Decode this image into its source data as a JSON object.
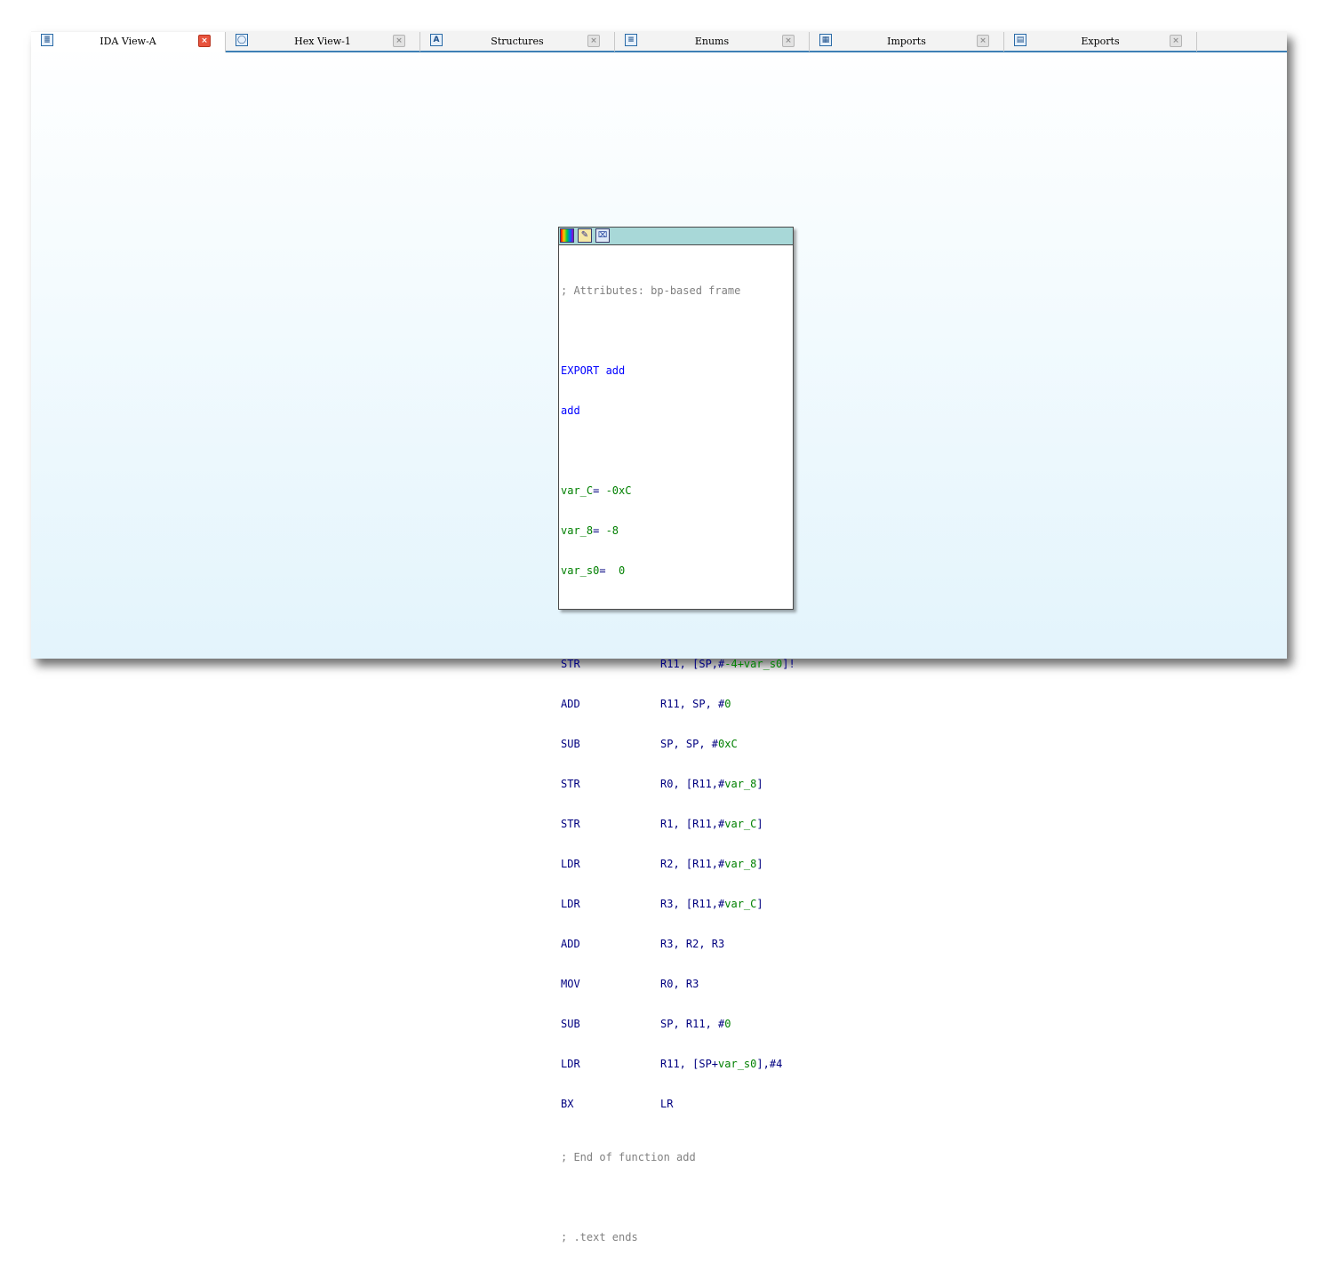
{
  "tabs": [
    {
      "label": "IDA View-A",
      "icon": "ida-view-icon",
      "glyph": "≣",
      "active": true
    },
    {
      "label": "Hex View-1",
      "icon": "hex-view-icon",
      "glyph": "◯",
      "active": false
    },
    {
      "label": "Structures",
      "icon": "structures-icon",
      "glyph": "A",
      "active": false
    },
    {
      "label": "Enums",
      "icon": "enums-icon",
      "glyph": "≡",
      "active": false
    },
    {
      "label": "Imports",
      "icon": "imports-icon",
      "glyph": "▦",
      "active": false
    },
    {
      "label": "Exports",
      "icon": "exports-icon",
      "glyph": "▤",
      "active": false
    }
  ],
  "close_glyph": "×",
  "node": {
    "titlebar_buttons": [
      {
        "name": "color-icon",
        "glyph": ""
      },
      {
        "name": "edit-icon",
        "glyph": "✎"
      },
      {
        "name": "graph-icon",
        "glyph": "⌧"
      }
    ],
    "attributes_comment": "; Attributes: bp-based frame",
    "export_line": "EXPORT add",
    "func_label": "add",
    "vars": [
      {
        "name": "var_C",
        "sep": "= ",
        "value": "-0xC"
      },
      {
        "name": "var_8",
        "sep": "= ",
        "value": "-8"
      },
      {
        "name": "var_s0",
        "sep": "=  ",
        "value": "0"
      }
    ],
    "instructions": [
      {
        "mnemonic": "STR",
        "parts": [
          "R11, [SP,#",
          "-4+var_s0",
          "]!"
        ]
      },
      {
        "mnemonic": "ADD",
        "parts": [
          "R11, SP, #",
          "0",
          ""
        ]
      },
      {
        "mnemonic": "SUB",
        "parts": [
          "SP, SP, #",
          "0xC",
          ""
        ]
      },
      {
        "mnemonic": "STR",
        "parts": [
          "R0, [R11,#",
          "var_8",
          "]"
        ]
      },
      {
        "mnemonic": "STR",
        "parts": [
          "R1, [R11,#",
          "var_C",
          "]"
        ]
      },
      {
        "mnemonic": "LDR",
        "parts": [
          "R2, [R11,#",
          "var_8",
          "]"
        ]
      },
      {
        "mnemonic": "LDR",
        "parts": [
          "R3, [R11,#",
          "var_C",
          "]"
        ]
      },
      {
        "mnemonic": "ADD",
        "parts": [
          "R3, R2, R3",
          "",
          ""
        ]
      },
      {
        "mnemonic": "MOV",
        "parts": [
          "R0, R3",
          "",
          ""
        ]
      },
      {
        "mnemonic": "SUB",
        "parts": [
          "SP, R11, #",
          "0",
          ""
        ]
      },
      {
        "mnemonic": "LDR",
        "parts": [
          "R11, [SP+",
          "var_s0",
          "],#4"
        ]
      },
      {
        "mnemonic": "BX",
        "parts": [
          "LR",
          "",
          ""
        ]
      }
    ],
    "end_comment": "; End of function add",
    "text_ends_comment": "; .text ends"
  }
}
